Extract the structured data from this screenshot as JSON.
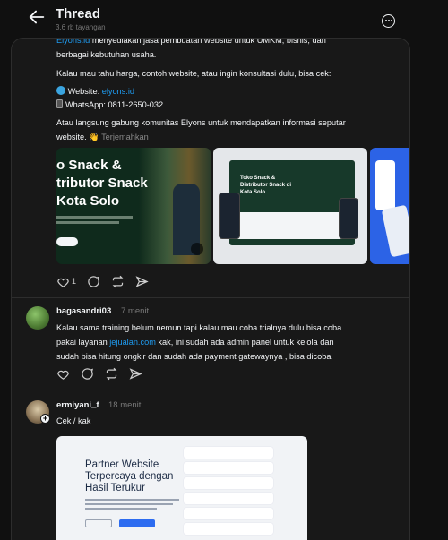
{
  "header": {
    "title": "Thread",
    "views": "3,6 rb tayangan"
  },
  "post": {
    "intro_link": "Elyons.id",
    "intro_rest": " menyediakan jasa pembuatan website untuk UMKM, bisnis, dan",
    "intro_line2": "berbagai kebutuhan usaha.",
    "cta": "Kalau mau tahu harga, contoh website, atau ingin konsultasi dulu, bisa cek:",
    "website_label": "Website: ",
    "website_link": "elyons.id",
    "whatsapp_label": "WhatsApp: 0811-2650-032",
    "community_line1": "Atau langsung gabung komunitas Elyons untuk mendapatkan informasi seputar",
    "community_line2": "website. 👋",
    "translate": "Terjemahkan",
    "like_count": "1",
    "images": {
      "img1_heading_line1": "o Snack &",
      "img1_heading_line2": "tributor Snack",
      "img1_heading_line3": "Kota Solo",
      "img2_heading": "Toko Snack & Distributor Snack di Kota Solo"
    }
  },
  "replies": [
    {
      "username": "bagasandri03",
      "time": "7 menit",
      "text_line1": "Kalau sama training belum nemun tapi kalau mau coba trialnya dulu bisa coba",
      "text_line2_pre": "pakai layanan ",
      "text_line2_link": "jejualan.com",
      "text_line2_post": " kak, ini sudah ada admin panel untuk kelola dan",
      "text_line3": "sudah bisa hitung ongkir dan sudah ada payment gatewaynya , bisa dicoba"
    },
    {
      "username": "ermiyani_f",
      "time": "18 menit",
      "text": "Cek / kak",
      "image_heading_line1": "Partner Website",
      "image_heading_line2": "Terpercaya dengan",
      "image_heading_line3": "Hasil Terukur"
    }
  ],
  "icons": {
    "back": "arrow-left-icon",
    "more": "more-circle-icon",
    "like": "heart-icon",
    "comment": "comment-icon",
    "repost": "repost-icon",
    "share": "send-icon",
    "globe": "globe-icon",
    "phone": "phone-icon"
  },
  "colors": {
    "background": "#101010",
    "card": "#181818",
    "link": "#1e9bf0"
  }
}
